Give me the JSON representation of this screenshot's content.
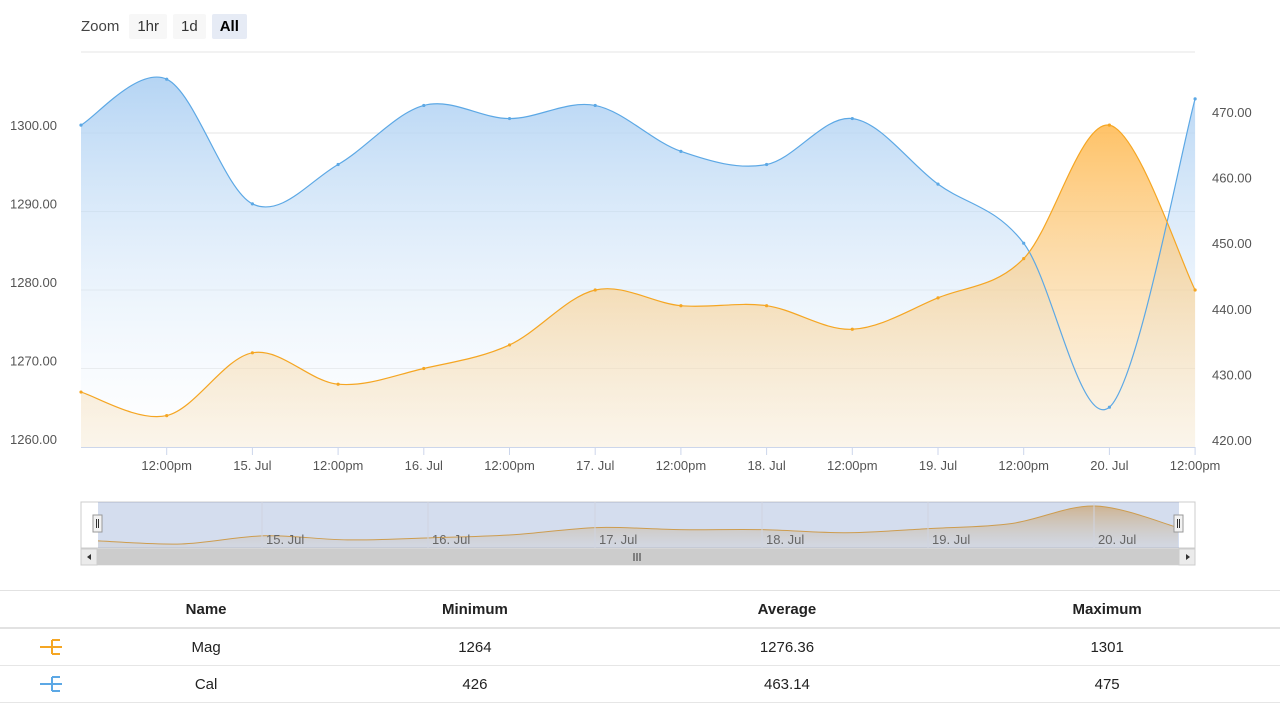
{
  "zoom": {
    "label": "Zoom",
    "buttons": [
      {
        "label": "1hr",
        "active": false
      },
      {
        "label": "1d",
        "active": false
      },
      {
        "label": "All",
        "active": true
      }
    ]
  },
  "chart_data": {
    "type": "area",
    "x_type": "datetime",
    "x_tick_labels": [
      "12:00pm",
      "15. Jul",
      "12:00pm",
      "16. Jul",
      "12:00pm",
      "17. Jul",
      "12:00pm",
      "18. Jul",
      "12:00pm",
      "19. Jul",
      "12:00pm",
      "20. Jul",
      "12:00pm"
    ],
    "navigator_labels": [
      "15. Jul",
      "16. Jul",
      "17. Jul",
      "18. Jul",
      "19. Jul",
      "20. Jul"
    ],
    "y_left": {
      "ticks": [
        "1260.00",
        "1270.00",
        "1280.00",
        "1290.00",
        "1300.00"
      ],
      "range": [
        1260,
        1300
      ],
      "grid": true
    },
    "y_right": {
      "ticks": [
        "420.00",
        "430.00",
        "440.00",
        "450.00",
        "460.00",
        "470.00"
      ],
      "range": [
        420,
        470
      ]
    },
    "series": [
      {
        "name": "Mag",
        "axis": "left",
        "color": "#f5a623",
        "x": [
          "2014-07-14 00:00",
          "2014-07-14 12:00",
          "2014-07-15 00:00",
          "2014-07-15 12:00",
          "2014-07-16 00:00",
          "2014-07-16 12:00",
          "2014-07-17 00:00",
          "2014-07-17 12:00",
          "2014-07-18 00:00",
          "2014-07-18 12:00",
          "2014-07-19 00:00",
          "2014-07-19 12:00",
          "2014-07-20 00:00",
          "2014-07-20 12:00"
        ],
        "values": [
          1267,
          1264,
          1272,
          1268,
          1270,
          1273,
          1280,
          1278,
          1278,
          1275,
          1279,
          1284,
          1301,
          1280
        ]
      },
      {
        "name": "Cal",
        "axis": "right",
        "color": "#5ca8e5",
        "x": [
          "2014-07-14 00:00",
          "2014-07-14 12:00",
          "2014-07-15 00:00",
          "2014-07-15 12:00",
          "2014-07-16 00:00",
          "2014-07-16 12:00",
          "2014-07-17 00:00",
          "2014-07-17 12:00",
          "2014-07-18 00:00",
          "2014-07-18 12:00",
          "2014-07-19 00:00",
          "2014-07-19 12:00",
          "2014-07-20 00:00",
          "2014-07-20 12:00"
        ],
        "values": [
          468,
          475,
          456,
          462,
          471,
          469,
          471,
          464,
          462,
          469,
          459,
          450,
          425,
          472
        ]
      }
    ]
  },
  "table": {
    "headers": [
      "Name",
      "Minimum",
      "Average",
      "Maximum"
    ],
    "rows": [
      {
        "icon": "orange-series-icon",
        "color": "#f5a623",
        "name": "Mag",
        "min": "1264",
        "avg": "1276.36",
        "max": "1301"
      },
      {
        "icon": "blue-series-icon",
        "color": "#5ca8e5",
        "name": "Cal",
        "min": "426",
        "avg": "463.14",
        "max": "475"
      }
    ]
  }
}
